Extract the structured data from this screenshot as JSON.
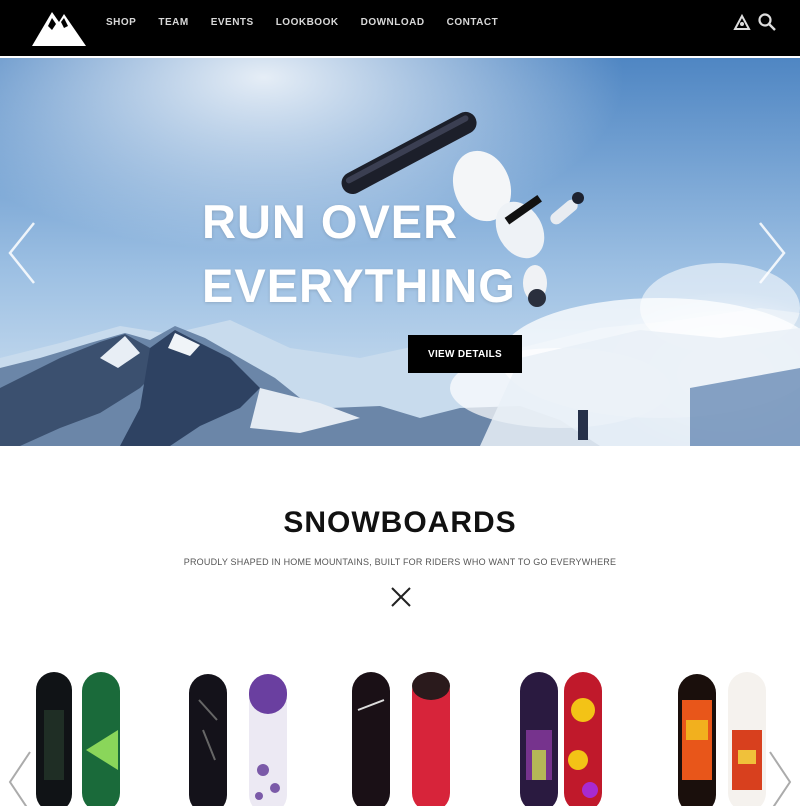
{
  "header": {
    "logo_icon": "mountain-logo",
    "nav": [
      "SHOP",
      "TEAM",
      "EVENTS",
      "LOOKBOOK",
      "DOWNLOAD",
      "CONTACT"
    ],
    "icons": [
      "account-icon",
      "search-icon"
    ]
  },
  "hero": {
    "title_line1": "RUN OVER",
    "title_line2": "EVERYTHING",
    "cta_label": "VIEW DETAILS",
    "arrows": [
      "chevron-left-icon",
      "chevron-right-icon"
    ]
  },
  "section": {
    "title": "SNOWBOARDS",
    "subtitle": "PROUDLY SHAPED IN HOME MOUNTAINS, BUILT FOR RIDERS WHO WANT TO GO EVERYWHERE",
    "divider_icon": "crossed-skis-icon"
  },
  "colors": {
    "header_bg": "#000000",
    "accent": "#000000",
    "sky_top": "#5f93cc",
    "sky_bottom": "#bcd4ea"
  },
  "products": [
    {
      "name": "board-pair-1"
    },
    {
      "name": "board-pair-2"
    },
    {
      "name": "board-pair-3"
    },
    {
      "name": "board-pair-4"
    },
    {
      "name": "board-pair-5"
    }
  ]
}
